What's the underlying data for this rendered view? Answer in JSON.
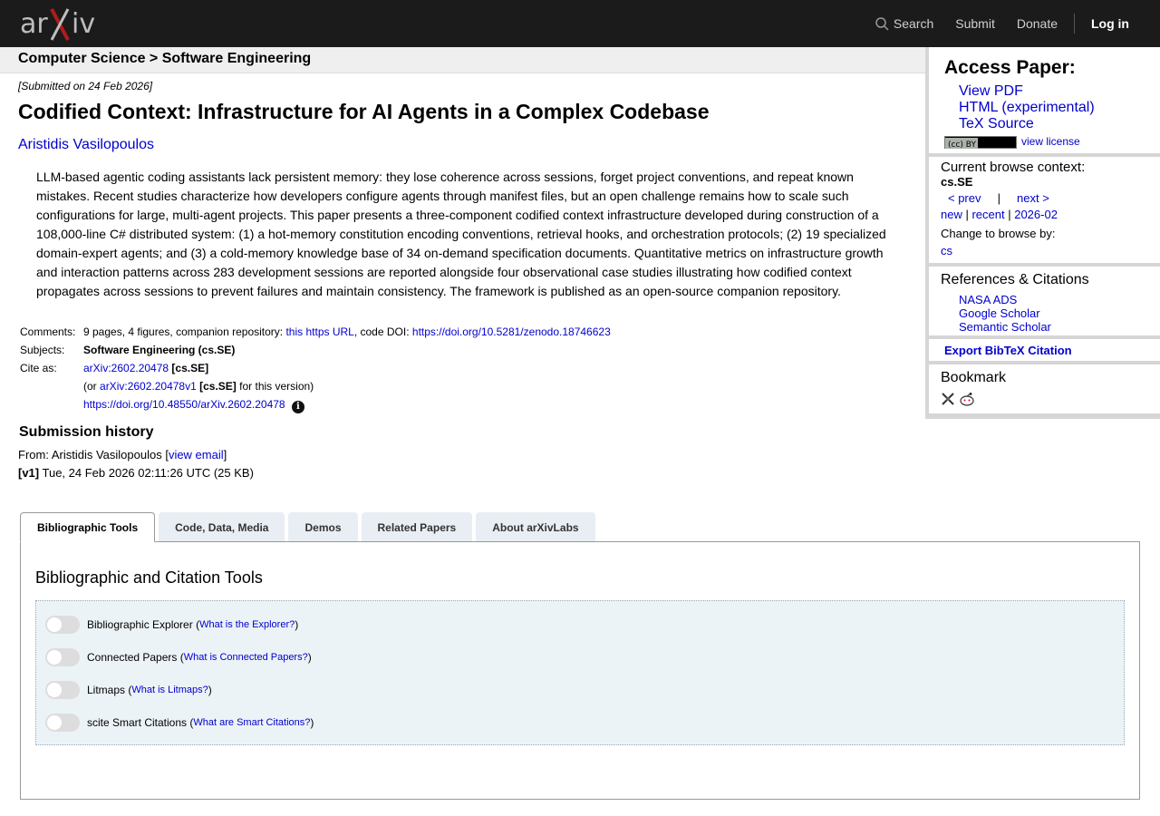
{
  "header": {
    "logo_text": "arXiv",
    "nav": {
      "search": "Search",
      "submit": "Submit",
      "donate": "Donate",
      "login": "Log in"
    }
  },
  "breadcrumb": "Computer Science > Software Engineering",
  "paper": {
    "submitted": "[Submitted on 24 Feb 2026]",
    "title": "Codified Context: Infrastructure for AI Agents in a Complex Codebase",
    "author": "Aristidis Vasilopoulos",
    "abstract": "LLM-based agentic coding assistants lack persistent memory: they lose coherence across sessions, forget project conventions, and repeat known mistakes. Recent studies characterize how developers configure agents through manifest files, but an open challenge remains how to scale such configurations for large, multi-agent projects. This paper presents a three-component codified context infrastructure developed during construction of a 108,000-line C# distributed system: (1) a hot-memory constitution encoding conventions, retrieval hooks, and orchestration protocols; (2) 19 specialized domain-expert agents; and (3) a cold-memory knowledge base of 34 on-demand specification documents. Quantitative metrics on infrastructure growth and interaction patterns across 283 development sessions are reported alongside four observational case studies illustrating how codified context propagates across sessions to prevent failures and maintain consistency. The framework is published as an open-source companion repository."
  },
  "meta": {
    "comments_label": "Comments:",
    "comments_pre": "9 pages, 4 figures, companion repository:",
    "comments_link": "this https URL",
    "comments_mid": ", code DOI:",
    "comments_doi": "https://doi.org/10.5281/zenodo.18746623",
    "subjects_label": "Subjects:",
    "subjects": "Software Engineering (cs.SE)",
    "cite_label": "Cite as:",
    "cite_id": "arXiv:2602.20478",
    "cite_cat": "[cs.SE]",
    "or_pre": "(or",
    "cite_v1": "arXiv:2602.20478v1",
    "or_post": "for this version)",
    "doi": "https://doi.org/10.48550/arXiv.2602.20478"
  },
  "history": {
    "heading": "Submission history",
    "from_pre": "From: Aristidis Vasilopoulos [",
    "view_email": "view email",
    "from_post": "]",
    "version": "[v1]",
    "version_date": "Tue, 24 Feb 2026 02:11:26 UTC (25 KB)"
  },
  "tabs": [
    "Bibliographic Tools",
    "Code, Data, Media",
    "Demos",
    "Related Papers",
    "About arXivLabs"
  ],
  "panel": {
    "title": "Bibliographic and Citation Tools",
    "tools": [
      {
        "name": "Bibliographic Explorer",
        "link": "What is the Explorer?"
      },
      {
        "name": "Connected Papers",
        "link": "What is Connected Papers?"
      },
      {
        "name": "Litmaps",
        "link": "What is Litmaps?"
      },
      {
        "name": "scite Smart Citations",
        "link": "What are Smart Citations?"
      }
    ]
  },
  "sidebar": {
    "access_heading": "Access Paper:",
    "access_links": [
      "View PDF",
      "HTML (experimental)",
      "TeX Source"
    ],
    "license_badge": "(cc) BY",
    "view_license": "view license",
    "context_heading": "Current browse context:",
    "context_code": "cs.SE",
    "prev": "< prev",
    "sep": "|",
    "next": "next >",
    "new": "new",
    "recent": "recent",
    "month": "2026-02",
    "change_label": "Change to browse by:",
    "cs": "cs",
    "refs_heading": "References & Citations",
    "refs": [
      "NASA ADS",
      "Google Scholar",
      "Semantic Scholar"
    ],
    "bibtex": "Export BibTeX Citation",
    "bookmark": "Bookmark"
  },
  "colors": {
    "topbar": "#1b1b1b",
    "link": "#0000cc",
    "logo_x": "#b31b1b"
  }
}
